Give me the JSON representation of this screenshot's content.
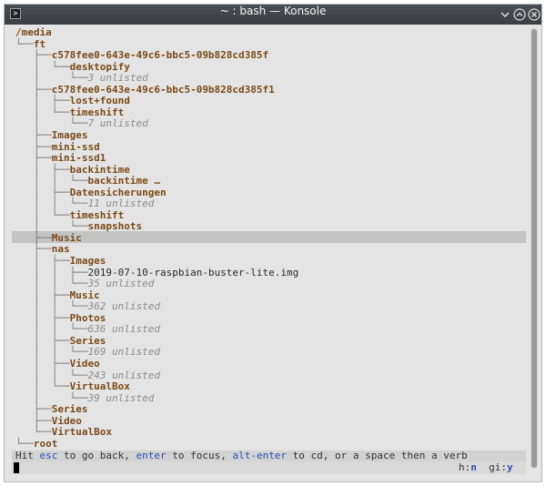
{
  "window": {
    "title": "~ : bash — Konsole",
    "app_icon": "terminal-icon",
    "buttons": [
      "chevron-down-icon",
      "maximize-icon",
      "close-icon"
    ]
  },
  "tree": [
    {
      "guide": "",
      "text": "/media",
      "kind": "d"
    },
    {
      "guide": "└──",
      "text": "ft",
      "kind": "d"
    },
    {
      "guide": "   ├──",
      "text": "c578fee0-643e-49c6-bbc5-09b828cd385f",
      "kind": "d"
    },
    {
      "guide": "   │  └──",
      "text": "desktopify",
      "kind": "d"
    },
    {
      "guide": "   │     └──",
      "text": "3 unlisted",
      "kind": "u"
    },
    {
      "guide": "   ├──",
      "text": "c578fee0-643e-49c6-bbc5-09b828cd385f1",
      "kind": "d"
    },
    {
      "guide": "   │  ├──",
      "text": "lost+found",
      "kind": "d"
    },
    {
      "guide": "   │  └──",
      "text": "timeshift",
      "kind": "d"
    },
    {
      "guide": "   │     └──",
      "text": "7 unlisted",
      "kind": "u"
    },
    {
      "guide": "   ├──",
      "text": "Images",
      "kind": "d"
    },
    {
      "guide": "   ├──",
      "text": "mini-ssd",
      "kind": "d"
    },
    {
      "guide": "   ├──",
      "text": "mini-ssd1",
      "kind": "d"
    },
    {
      "guide": "   │  ├──",
      "text": "backintime",
      "kind": "d"
    },
    {
      "guide": "   │  │  └──",
      "text": "backintime …",
      "kind": "d"
    },
    {
      "guide": "   │  ├──",
      "text": "Datensicherungen",
      "kind": "d"
    },
    {
      "guide": "   │  │  └──",
      "text": "11 unlisted",
      "kind": "u"
    },
    {
      "guide": "   │  └──",
      "text": "timeshift",
      "kind": "d"
    },
    {
      "guide": "   │     └──",
      "text": "snapshots",
      "kind": "d"
    },
    {
      "guide": "   ├──",
      "text": "Music",
      "kind": "d",
      "selected": true
    },
    {
      "guide": "   ├──",
      "text": "nas",
      "kind": "d"
    },
    {
      "guide": "   │  ├──",
      "text": "Images",
      "kind": "d"
    },
    {
      "guide": "   │  │  ├──",
      "text": "2019-07-10-raspbian-buster-lite.img",
      "kind": "f"
    },
    {
      "guide": "   │  │  └──",
      "text": "35 unlisted",
      "kind": "u"
    },
    {
      "guide": "   │  ├──",
      "text": "Music",
      "kind": "d"
    },
    {
      "guide": "   │  │  └──",
      "text": "362 unlisted",
      "kind": "u"
    },
    {
      "guide": "   │  ├──",
      "text": "Photos",
      "kind": "d"
    },
    {
      "guide": "   │  │  └──",
      "text": "636 unlisted",
      "kind": "u"
    },
    {
      "guide": "   │  ├──",
      "text": "Series",
      "kind": "d"
    },
    {
      "guide": "   │  │  └──",
      "text": "169 unlisted",
      "kind": "u"
    },
    {
      "guide": "   │  ├──",
      "text": "Video",
      "kind": "d"
    },
    {
      "guide": "   │  │  └──",
      "text": "243 unlisted",
      "kind": "u"
    },
    {
      "guide": "   │  └──",
      "text": "VirtualBox",
      "kind": "d"
    },
    {
      "guide": "   │     └──",
      "text": "39 unlisted",
      "kind": "u"
    },
    {
      "guide": "   ├──",
      "text": "Series",
      "kind": "d"
    },
    {
      "guide": "   ├──",
      "text": "Video",
      "kind": "d"
    },
    {
      "guide": "   └──",
      "text": "VirtualBox",
      "kind": "d"
    },
    {
      "guide": "└──",
      "text": "root",
      "kind": "d"
    }
  ],
  "status": {
    "p1": "Hit ",
    "k1": "esc",
    "p2": " to go back, ",
    "k2": "enter",
    "p3": " to focus, ",
    "k3": "alt-enter",
    "p4": " to cd, or a space then a verb"
  },
  "indicators": {
    "h_label": "h:",
    "h_value": "n",
    "gi_label": "gi:",
    "gi_value": "y"
  },
  "colors": {
    "directory": "#7a4a18",
    "unlisted": "#8c8c8c",
    "key": "#2f4fb5",
    "selection": "#c3c3c3"
  }
}
